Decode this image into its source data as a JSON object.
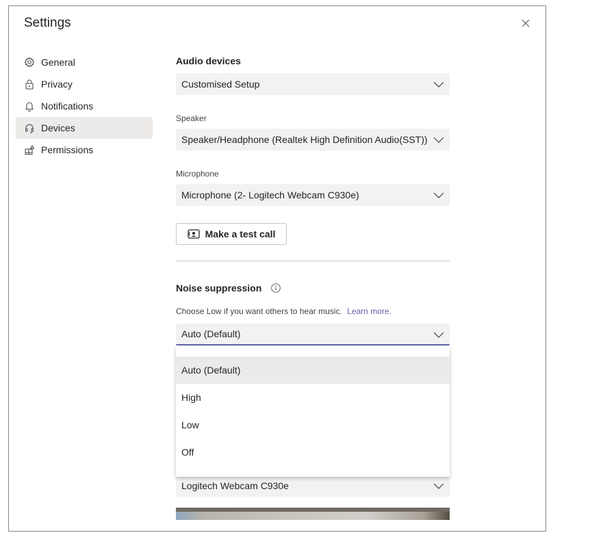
{
  "window": {
    "title": "Settings"
  },
  "nav": {
    "items": [
      {
        "label": "General",
        "icon": "gear-icon",
        "active": false
      },
      {
        "label": "Privacy",
        "icon": "lock-icon",
        "active": false
      },
      {
        "label": "Notifications",
        "icon": "bell-icon",
        "active": false
      },
      {
        "label": "Devices",
        "icon": "headset-icon",
        "active": true
      },
      {
        "label": "Permissions",
        "icon": "permissions-icon",
        "active": false
      }
    ]
  },
  "audio": {
    "section_title": "Audio devices",
    "device_setup_value": "Customised Setup",
    "speaker_label": "Speaker",
    "speaker_value": "Speaker/Headphone (Realtek High Definition Audio(SST))",
    "microphone_label": "Microphone",
    "microphone_value": "Microphone (2- Logitech Webcam C930e)",
    "test_call_label": "Make a test call"
  },
  "noise": {
    "section_title": "Noise suppression",
    "description": "Choose Low if you want others to hear music.",
    "learn_more": "Learn more.",
    "selected_value": "Auto (Default)",
    "options": [
      "Auto (Default)",
      "High",
      "Low",
      "Off"
    ]
  },
  "camera": {
    "value": "Logitech Webcam C930e"
  },
  "colors": {
    "accent": "#6264a7",
    "selected_bg": "#edebe9",
    "select_bg": "#f3f2f1"
  }
}
